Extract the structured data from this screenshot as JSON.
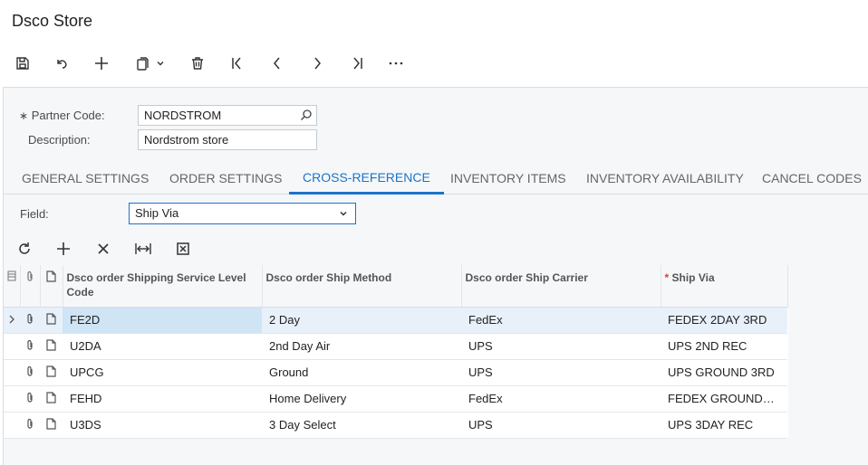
{
  "app": {
    "title": "Dsco Store"
  },
  "toolbar": {
    "save": "save-icon",
    "undo": "undo-icon",
    "add": "plus-icon",
    "copy": "copy-icon",
    "delete": "trash-icon",
    "first": "first-icon",
    "prev": "prev-icon",
    "next": "next-icon",
    "last": "last-icon",
    "more": "more-icon"
  },
  "form": {
    "partner_code_label": "Partner Code:",
    "partner_code_value": "NORDSTROM",
    "description_label": "Description:",
    "description_value": "Nordstrom store"
  },
  "tabs": [
    {
      "label": "GENERAL SETTINGS"
    },
    {
      "label": "ORDER SETTINGS"
    },
    {
      "label": "CROSS-REFERENCE"
    },
    {
      "label": "INVENTORY ITEMS"
    },
    {
      "label": "INVENTORY AVAILABILITY"
    },
    {
      "label": "CANCEL CODES"
    }
  ],
  "active_tab": "CROSS-REFERENCE",
  "field": {
    "label": "Field:",
    "value": "Ship Via"
  },
  "grid": {
    "columns": [
      "Dsco order Shipping Service Level Code",
      "Dsco order Ship Method",
      "Dsco order Ship Carrier",
      "Ship Via"
    ],
    "rows": [
      {
        "code": "FE2D",
        "method": "2 Day",
        "carrier": "FedEx",
        "via": "FEDEX 2DAY 3RD"
      },
      {
        "code": "U2DA",
        "method": "2nd Day Air",
        "carrier": "UPS",
        "via": "UPS 2ND REC"
      },
      {
        "code": "UPCG",
        "method": "Ground",
        "carrier": "UPS",
        "via": "UPS GROUND 3RD"
      },
      {
        "code": "FEHD",
        "method": "Home Delivery",
        "carrier": "FedEx",
        "via": "FEDEX GROUND…"
      },
      {
        "code": "U3DS",
        "method": "3 Day Select",
        "carrier": "UPS",
        "via": "UPS 3DAY REC"
      }
    ]
  },
  "colors": {
    "accent": "#1c73c8",
    "selected_row": "#e8f1fa"
  }
}
